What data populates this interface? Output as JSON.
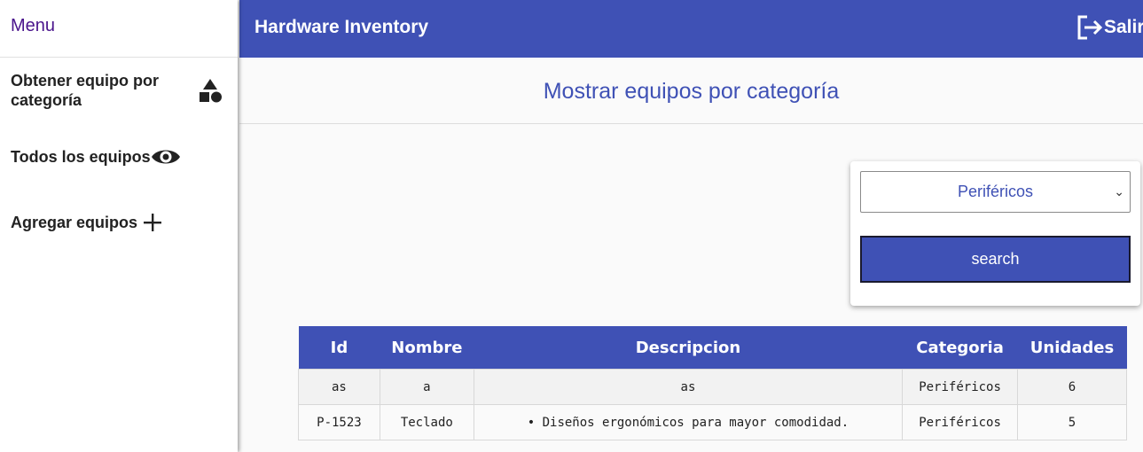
{
  "sidebar": {
    "title": "Menu",
    "items": [
      {
        "label": "Obtener equipo por categoría",
        "icon": "shapes-icon"
      },
      {
        "label": "Todos los equipos",
        "icon": "eye-icon"
      },
      {
        "label": "Agregar equipos",
        "icon": "plus-icon"
      }
    ]
  },
  "header": {
    "title": "Hardware Inventory",
    "exit_label": "Salir",
    "color": "#3f51b5"
  },
  "main": {
    "page_title": "Mostrar equipos por categoría",
    "category_select": {
      "value": "Periféricos"
    },
    "search_button": "search"
  },
  "table": {
    "headers": [
      "Id",
      "Nombre",
      "Descripcion",
      "Categoria",
      "Unidades"
    ],
    "rows": [
      [
        "as",
        "a",
        "as",
        "Periféricos",
        "6"
      ],
      [
        "P-1523",
        "Teclado",
        "• Diseños ergonómicos para mayor comodidad.",
        "Periféricos",
        "5"
      ]
    ]
  }
}
